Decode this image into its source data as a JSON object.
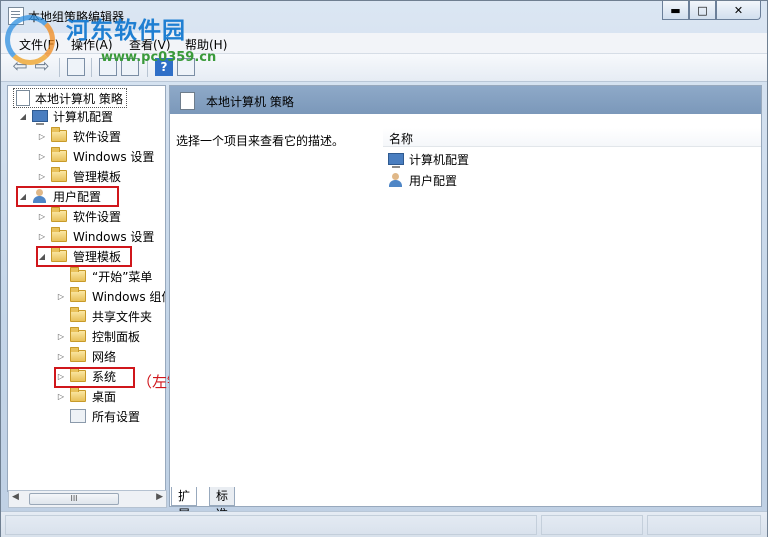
{
  "window": {
    "title": "本地组策略编辑器",
    "minimize_glyph": "▬",
    "maximize_glyph": "□",
    "close_glyph": "✕"
  },
  "watermark": {
    "site_name": "河东软件园",
    "url": "www.pc0359.cn"
  },
  "menu": [
    "文件(F)",
    "操作(A)",
    "查看(V)",
    "帮助(H)"
  ],
  "toolbar": {
    "back_glyph": "⇦",
    "forward_glyph": "⇨",
    "help_glyph": "?"
  },
  "tree": {
    "root": "本地计算机 策略",
    "computer_config": "计算机配置",
    "cc_software": "软件设置",
    "cc_windows": "Windows 设置",
    "cc_admin": "管理模板",
    "user_config": "用户配置",
    "uc_software": "软件设置",
    "uc_windows": "Windows 设置",
    "uc_admin": "管理模板",
    "start_menu": "“开始”菜单",
    "windows_components": "Windows 组件",
    "shared_folders": "共享文件夹",
    "control_panel": "控制面板",
    "network": "网络",
    "system": "系统",
    "desktop": "桌面",
    "all_settings": "所有设置"
  },
  "annotation": "（左键单击）",
  "scrollbar_grip": "III",
  "right_pane": {
    "header": "本地计算机 策略",
    "description": "选择一个项目来查看它的描述。",
    "column_name": "名称",
    "items": [
      "计算机配置",
      "用户配置"
    ]
  },
  "tabs": [
    "扩展",
    "标准"
  ],
  "colors": {
    "highlight": "#d0161b",
    "header": "#7f9bbd"
  }
}
